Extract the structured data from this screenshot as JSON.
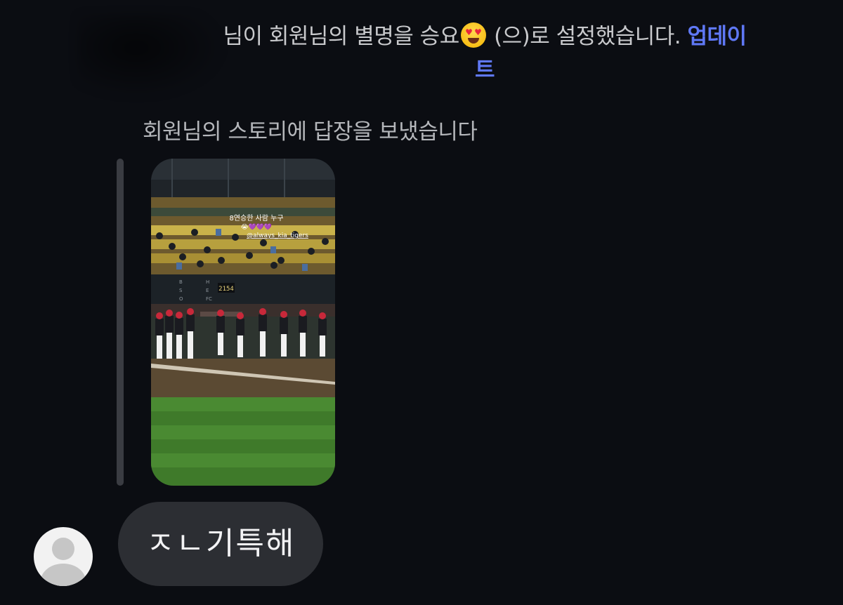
{
  "system_notice": {
    "text_before": "님이 회원님의 별명을 승요",
    "emoji_icon": "smiling-face-with-heart-eyes-icon",
    "text_after": " (으)로 설정했습니다. ",
    "update_link": "업데이트",
    "link_color": "#5f78f5"
  },
  "story_reply": {
    "label": "회원님의 스토리에 답장을 보냈습니다",
    "story_caption_line1": "8연승한 사람 누구",
    "story_caption_line2": "😭💜💜💜",
    "story_mention": "@always_kia_tigers",
    "scoreboard_number": "2154",
    "scoreboard_letters": [
      "B",
      "S",
      "O",
      "H",
      "E",
      "FC"
    ]
  },
  "message": {
    "text": "ㅈㄴ기특해",
    "bubble_color": "#2c2e33"
  },
  "avatar": {
    "icon": "default-user-avatar-icon"
  }
}
